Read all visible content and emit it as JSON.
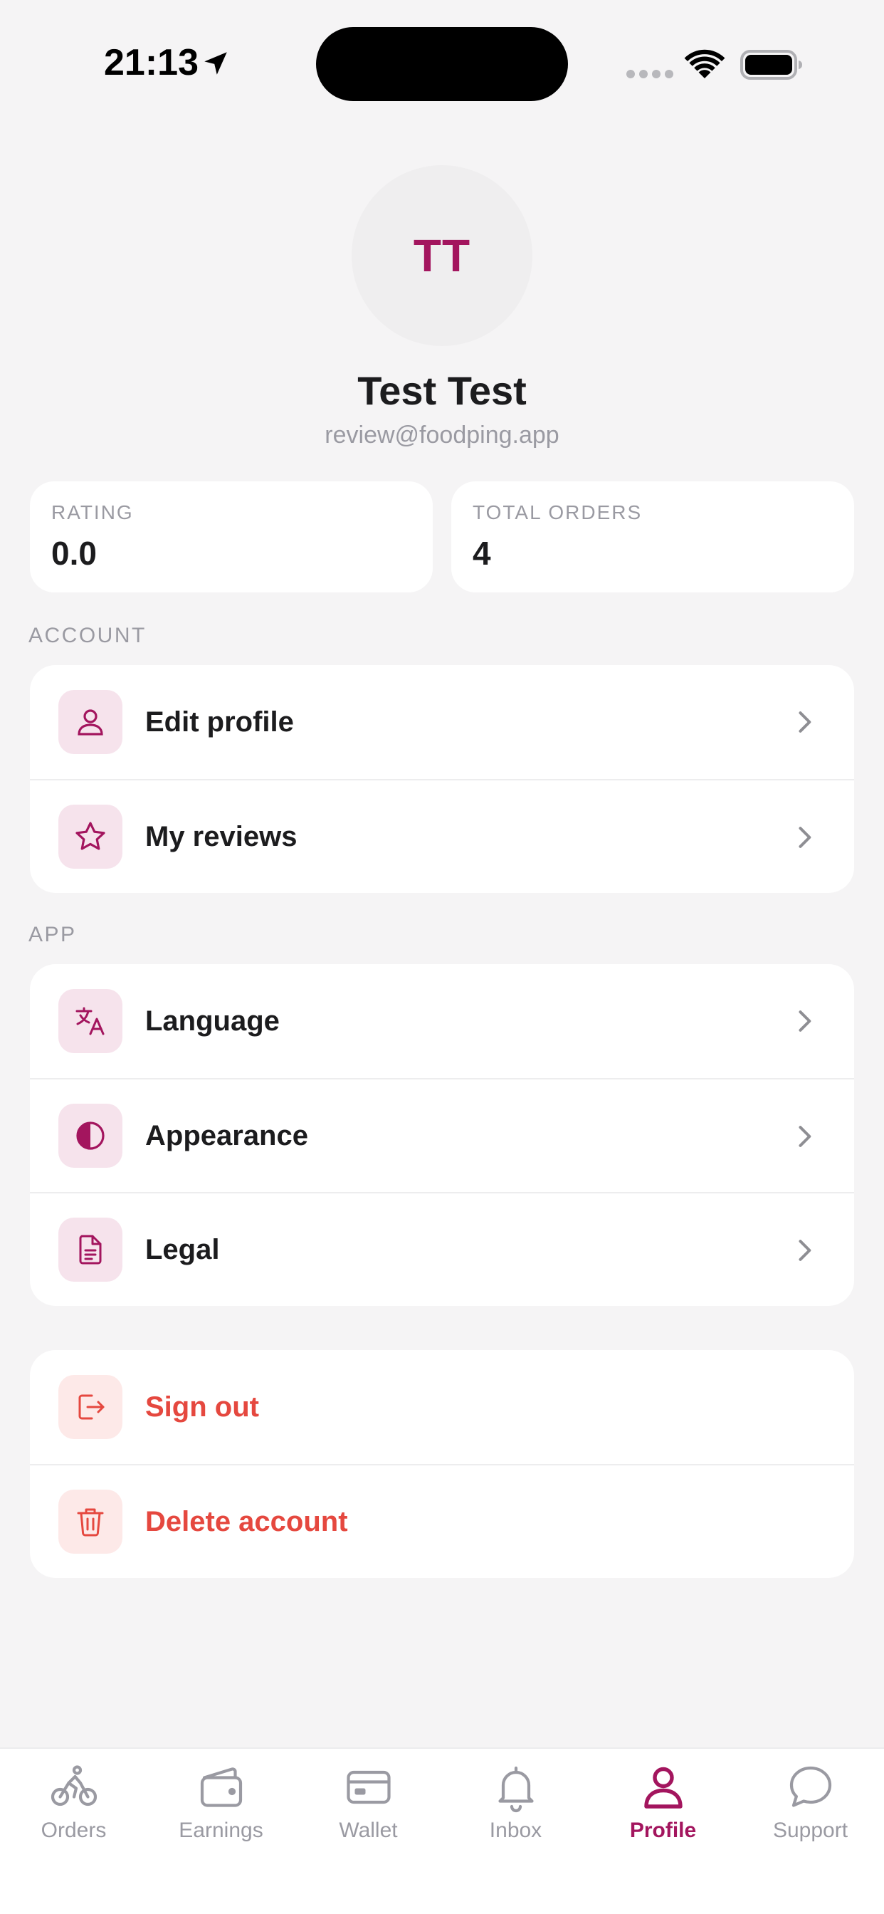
{
  "status_bar": {
    "time": "21:13"
  },
  "profile": {
    "initials": "TT",
    "name": "Test Test",
    "email": "review@foodping.app"
  },
  "stats": [
    {
      "label": "RATING",
      "value": "0.0"
    },
    {
      "label": "TOTAL ORDERS",
      "value": "4"
    }
  ],
  "sections": {
    "account": {
      "title": "ACCOUNT",
      "items": [
        {
          "label": "Edit profile",
          "icon": "user-icon"
        },
        {
          "label": "My reviews",
          "icon": "star-icon"
        }
      ]
    },
    "app": {
      "title": "APP",
      "items": [
        {
          "label": "Language",
          "icon": "translate-icon"
        },
        {
          "label": "Appearance",
          "icon": "contrast-icon"
        },
        {
          "label": "Legal",
          "icon": "document-icon"
        }
      ]
    },
    "danger": {
      "items": [
        {
          "label": "Sign out",
          "icon": "sign-out-icon"
        },
        {
          "label": "Delete account",
          "icon": "trash-icon"
        }
      ]
    }
  },
  "tabs": [
    {
      "label": "Orders",
      "icon": "bicycle-icon"
    },
    {
      "label": "Earnings",
      "icon": "wallet-icon"
    },
    {
      "label": "Wallet",
      "icon": "card-icon"
    },
    {
      "label": "Inbox",
      "icon": "bell-icon"
    },
    {
      "label": "Profile",
      "icon": "person-icon",
      "active": true
    },
    {
      "label": "Support",
      "icon": "chat-icon"
    }
  ],
  "colors": {
    "accent": "#a3155e",
    "danger": "#e5483f",
    "background": "#f5f4f5",
    "muted": "#9a9aa2"
  }
}
